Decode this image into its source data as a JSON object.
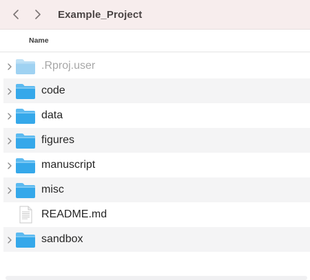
{
  "window": {
    "title": "Example_Project"
  },
  "header": {
    "name_column": "Name"
  },
  "items": [
    {
      "label": ".Rproj.user",
      "type": "folder",
      "dimmed": true
    },
    {
      "label": "code",
      "type": "folder",
      "dimmed": false
    },
    {
      "label": "data",
      "type": "folder",
      "dimmed": false
    },
    {
      "label": "figures",
      "type": "folder",
      "dimmed": false
    },
    {
      "label": "manuscript",
      "type": "folder",
      "dimmed": false
    },
    {
      "label": "misc",
      "type": "folder",
      "dimmed": false
    },
    {
      "label": "README.md",
      "type": "document",
      "dimmed": false
    },
    {
      "label": "sandbox",
      "type": "folder",
      "dimmed": false
    }
  ],
  "colors": {
    "toolbar_bg": "#f7eded",
    "folder_blue": "#35a8ea",
    "folder_tab": "#5cbaf0",
    "folder_dim": "#9fd2f2",
    "row_alt": "#f4f4f5"
  },
  "icons": {
    "back": "chevron-left-icon",
    "forward": "chevron-right-icon",
    "disclosure": "chevron-right-icon",
    "folder": "folder-icon",
    "document": "document-icon"
  }
}
